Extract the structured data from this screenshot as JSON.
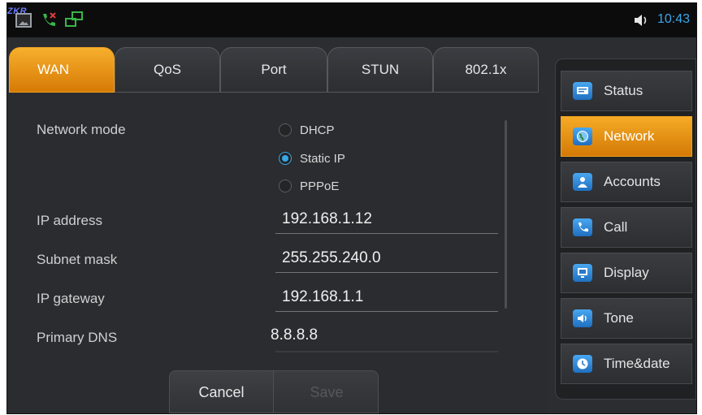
{
  "status_bar": {
    "brand": "ZKR",
    "time": "10:43"
  },
  "tabs": [
    {
      "label": "WAN",
      "active": true
    },
    {
      "label": "QoS",
      "active": false
    },
    {
      "label": "Port",
      "active": false
    },
    {
      "label": "STUN",
      "active": false
    },
    {
      "label": "802.1x",
      "active": false
    }
  ],
  "form": {
    "network_mode_label": "Network mode",
    "network_mode_options": [
      {
        "label": "DHCP",
        "selected": false
      },
      {
        "label": "Static IP",
        "selected": true
      },
      {
        "label": "PPPoE",
        "selected": false
      }
    ],
    "ip_address_label": "IP address",
    "ip_address_value": "192.168.1.12",
    "subnet_mask_label": "Subnet mask",
    "subnet_mask_value": "255.255.240.0",
    "ip_gateway_label": "IP gateway",
    "ip_gateway_value": "192.168.1.1",
    "primary_dns_label": "Primary DNS",
    "primary_dns_value": "8.8.8.8"
  },
  "buttons": {
    "cancel_label": "Cancel",
    "save_label": "Save"
  },
  "menu": [
    {
      "label": "Status",
      "icon": "status-icon",
      "active": false
    },
    {
      "label": "Network",
      "icon": "globe-icon",
      "active": true
    },
    {
      "label": "Accounts",
      "icon": "user-icon",
      "active": false
    },
    {
      "label": "Call",
      "icon": "phone-icon",
      "active": false
    },
    {
      "label": "Display",
      "icon": "monitor-icon",
      "active": false
    },
    {
      "label": "Tone",
      "icon": "speaker-icon",
      "active": false
    },
    {
      "label": "Time&date",
      "icon": "clock-icon",
      "active": false
    }
  ],
  "colors": {
    "accent": "#f0a020",
    "highlight_blue": "#3aa7e8",
    "background": "#2a2c2f"
  }
}
